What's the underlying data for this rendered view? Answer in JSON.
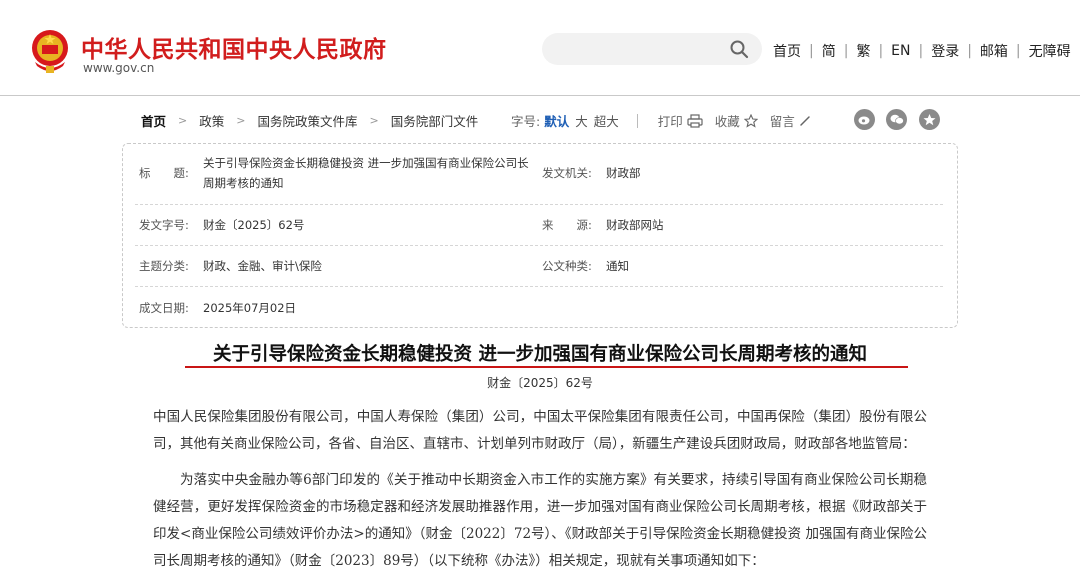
{
  "header": {
    "site_title": "中华人民共和国中央人民政府",
    "site_url": "www.gov.cn",
    "search_placeholder": "",
    "links": [
      "首页",
      "简",
      "繁",
      "EN",
      "登录",
      "邮箱",
      "无障碍"
    ]
  },
  "breadcrumb": {
    "items": [
      "首页",
      "政策",
      "国务院政策文件库",
      "国务院部门文件"
    ]
  },
  "tools": {
    "font_label": "字号:",
    "font_default": "默认",
    "font_large": "大",
    "font_xlarge": "超大",
    "print": "打印",
    "favorite": "收藏",
    "comment": "留言"
  },
  "share_icons": [
    "weibo-icon",
    "wechat-icon",
    "qzone-icon"
  ],
  "info": {
    "title_label": "标　　题:",
    "title_value": "关于引导保险资金长期稳健投资  进一步加强国有商业保险公司长周期考核的通知",
    "issuer_label": "发文机关:",
    "issuer_value": "财政部",
    "docno_label": "发文字号:",
    "docno_value": "财金〔2025〕62号",
    "source_label": "来　　源:",
    "source_value": "财政部网站",
    "topic_label": "主题分类:",
    "topic_value": "财政、金融、审计\\保险",
    "type_label": "公文种类:",
    "type_value": "通知",
    "date_label": "成文日期:",
    "date_value": "2025年07月02日"
  },
  "article": {
    "title": "关于引导保险资金长期稳健投资  进一步加强国有商业保险公司长周期考核的通知",
    "doc_number": "财金〔2025〕62号",
    "para1": "中国人民保险集团股份有限公司，中国人寿保险（集团）公司，中国太平保险集团有限责任公司，中国再保险（集团）股份有限公司，其他有关商业保险公司，各省、自治区、直辖市、计划单列市财政厅（局），新疆生产建设兵团财政局，财政部各地监管局：",
    "para2": "为落实中央金融办等6部门印发的《关于推动中长期资金入市工作的实施方案》有关要求，持续引导国有商业保险公司长期稳健经营，更好发挥保险资金的市场稳定器和经济发展助推器作用，进一步加强对国有商业保险公司长周期考核，根据《财政部关于印发<商业保险公司绩效评价办法>的通知》（财金〔2022〕72号）、《财政部关于引导保险资金长期稳健投资 加强国有商业保险公司长周期考核的通知》（财金〔2023〕89号）（以下统称《办法》）相关规定，现就有关事项通知如下："
  },
  "colors": {
    "brand_red": "#d11d1d",
    "accent_blue": "#1f5fb5",
    "title_underline": "#c91515"
  }
}
